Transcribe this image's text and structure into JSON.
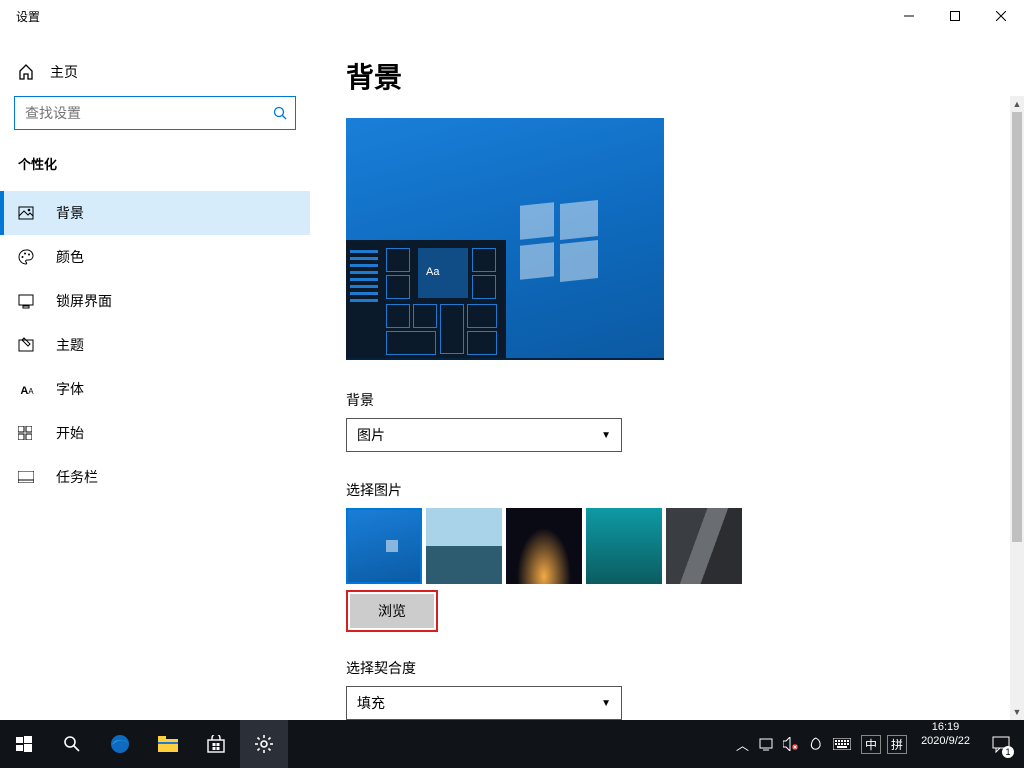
{
  "window": {
    "title": "设置"
  },
  "nav": {
    "home": "主页",
    "search_placeholder": "查找设置",
    "section": "个性化",
    "items": [
      {
        "label": "背景",
        "active": true
      },
      {
        "label": "颜色"
      },
      {
        "label": "锁屏界面"
      },
      {
        "label": "主题"
      },
      {
        "label": "字体"
      },
      {
        "label": "开始"
      },
      {
        "label": "任务栏"
      }
    ]
  },
  "content": {
    "heading": "背景",
    "preview_sample_text": "Aa",
    "bg_type_label": "背景",
    "bg_type_value": "图片",
    "choose_picture_label": "选择图片",
    "browse_button": "浏览",
    "fit_label": "选择契合度",
    "fit_value": "填充"
  },
  "taskbar": {
    "lang1": "中",
    "lang2": "拼",
    "time": "16:19",
    "date": "2020/9/22",
    "notif_count": "1"
  }
}
